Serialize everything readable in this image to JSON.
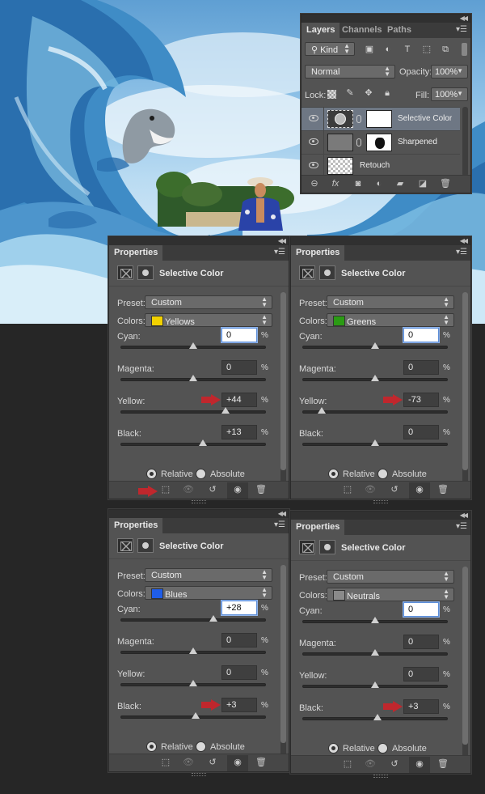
{
  "layers_panel": {
    "tabs": [
      "Layers",
      "Channels",
      "Paths"
    ],
    "filter_kind": "Kind",
    "blend_mode": "Normal",
    "opacity_label": "Opacity:",
    "opacity_value": "100%",
    "lock_label": "Lock:",
    "fill_label": "Fill:",
    "fill_value": "100%",
    "layers": [
      {
        "name": "Selective Color",
        "selected": true
      },
      {
        "name": "Sharpened",
        "selected": false
      },
      {
        "name": "Retouch",
        "selected": false
      }
    ]
  },
  "properties_panels": [
    {
      "tab": "Properties",
      "title": "Selective Color",
      "preset_label": "Preset:",
      "preset": "Custom",
      "colors_label": "Colors:",
      "colors": "Yellows",
      "swatch_color": "#f2d100",
      "sliders": [
        {
          "label": "Cyan:",
          "value": "0",
          "pos": 0.5,
          "selected": true,
          "arrow": false
        },
        {
          "label": "Magenta:",
          "value": "0",
          "pos": 0.5,
          "selected": false,
          "arrow": false
        },
        {
          "label": "Yellow:",
          "value": "+44",
          "pos": 0.72,
          "selected": false,
          "arrow": true
        },
        {
          "label": "Black:",
          "value": "+13",
          "pos": 0.565,
          "selected": false,
          "arrow": false
        }
      ],
      "percent": "%",
      "method_relative": "Relative",
      "method_absolute": "Absolute",
      "footer_arrow": true
    },
    {
      "tab": "Properties",
      "title": "Selective Color",
      "preset_label": "Preset:",
      "preset": "Custom",
      "colors_label": "Colors:",
      "colors": "Greens",
      "swatch_color": "#2b9b14",
      "sliders": [
        {
          "label": "Cyan:",
          "value": "0",
          "pos": 0.5,
          "selected": true,
          "arrow": false
        },
        {
          "label": "Magenta:",
          "value": "0",
          "pos": 0.5,
          "selected": false,
          "arrow": false
        },
        {
          "label": "Yellow:",
          "value": "-73",
          "pos": 0.135,
          "selected": false,
          "arrow": true
        },
        {
          "label": "Black:",
          "value": "0",
          "pos": 0.5,
          "selected": false,
          "arrow": false
        }
      ],
      "percent": "%",
      "method_relative": "Relative",
      "method_absolute": "Absolute",
      "footer_arrow": false
    },
    {
      "tab": "Properties",
      "title": "Selective Color",
      "preset_label": "Preset:",
      "preset": "Custom",
      "colors_label": "Colors:",
      "colors": "Blues",
      "swatch_color": "#1f5de8",
      "sliders": [
        {
          "label": "Cyan:",
          "value": "+28",
          "pos": 0.64,
          "selected": true,
          "arrow": false
        },
        {
          "label": "Magenta:",
          "value": "0",
          "pos": 0.5,
          "selected": false,
          "arrow": false
        },
        {
          "label": "Yellow:",
          "value": "0",
          "pos": 0.5,
          "selected": false,
          "arrow": false
        },
        {
          "label": "Black:",
          "value": "+3",
          "pos": 0.515,
          "selected": false,
          "arrow": true
        }
      ],
      "percent": "%",
      "method_relative": "Relative",
      "method_absolute": "Absolute",
      "footer_arrow": false
    },
    {
      "tab": "Properties",
      "title": "Selective Color",
      "preset_label": "Preset:",
      "preset": "Custom",
      "colors_label": "Colors:",
      "colors": "Neutrals",
      "swatch_color": "#8a8a8a",
      "sliders": [
        {
          "label": "Cyan:",
          "value": "0",
          "pos": 0.5,
          "selected": true,
          "arrow": false
        },
        {
          "label": "Magenta:",
          "value": "0",
          "pos": 0.5,
          "selected": false,
          "arrow": false
        },
        {
          "label": "Yellow:",
          "value": "0",
          "pos": 0.5,
          "selected": false,
          "arrow": false
        },
        {
          "label": "Black:",
          "value": "+3",
          "pos": 0.515,
          "selected": false,
          "arrow": true
        }
      ],
      "percent": "%",
      "method_relative": "Relative",
      "method_absolute": "Absolute",
      "footer_arrow": false
    }
  ],
  "colors": {
    "panel_bg": "#535353",
    "annotation_arrow": "#c0272d",
    "selected_layer": "#6e7784"
  }
}
